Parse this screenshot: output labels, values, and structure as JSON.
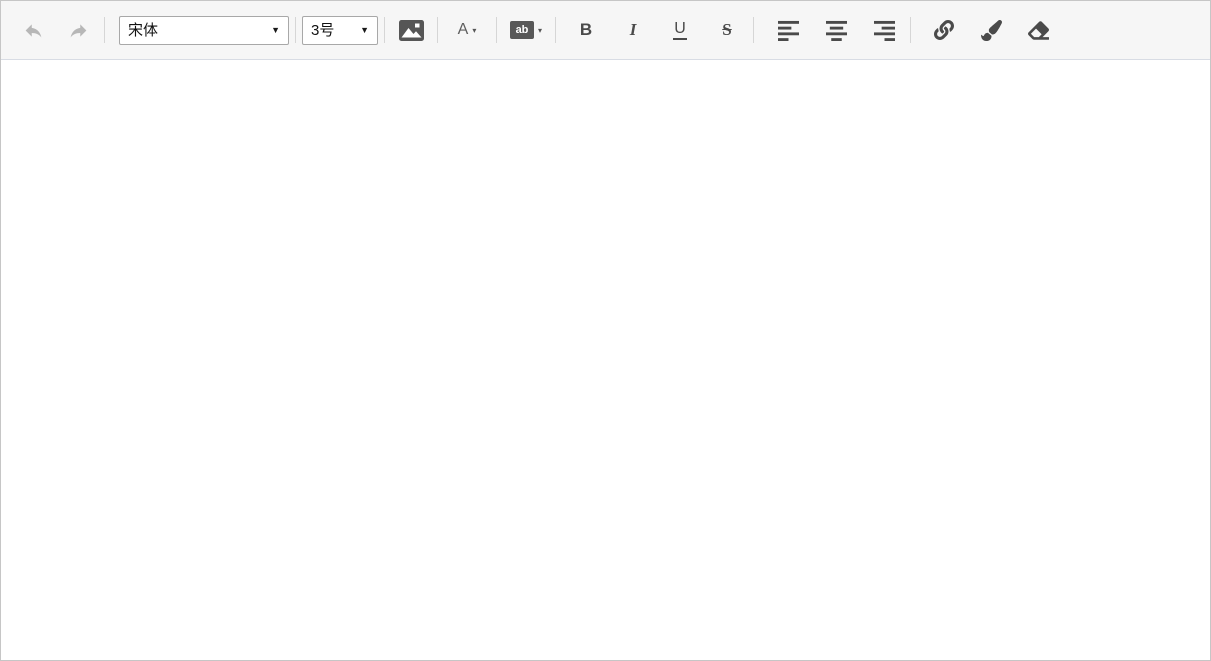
{
  "colors": {
    "toolbar_bg": "#f6f6f6",
    "outer_border": "#c6c6c6",
    "toolbar_bottom_border": "#d8dce4",
    "divider": "#d6d6d6",
    "icon": "#4a4a4a",
    "icon_disabled": "#b7b7b7",
    "select_border": "#a8a8a8",
    "select_text": "#111111",
    "badge_bg": "#585858",
    "badge_text": "#ffffff",
    "content_bg": "#ffffff"
  },
  "toolbar": {
    "font_family": {
      "value": "宋体",
      "arrow": "▼"
    },
    "font_size": {
      "value": "3号",
      "arrow": "▼"
    },
    "font_color": {
      "label": "A",
      "caret": "▾"
    },
    "highlight": {
      "label": "ab",
      "caret": "▾"
    },
    "bold_label": "B",
    "italic_label": "I",
    "underline_label": "U",
    "strikethrough_label": "S",
    "icon_names": [
      "undo-icon",
      "redo-icon",
      "image-icon",
      "font-color-icon",
      "highlight-color-icon",
      "bold-icon",
      "italic-icon",
      "underline-icon",
      "strikethrough-icon",
      "align-left-icon",
      "align-center-icon",
      "align-right-icon",
      "link-icon",
      "brush-icon",
      "eraser-icon"
    ]
  },
  "content": {
    "text": ""
  }
}
